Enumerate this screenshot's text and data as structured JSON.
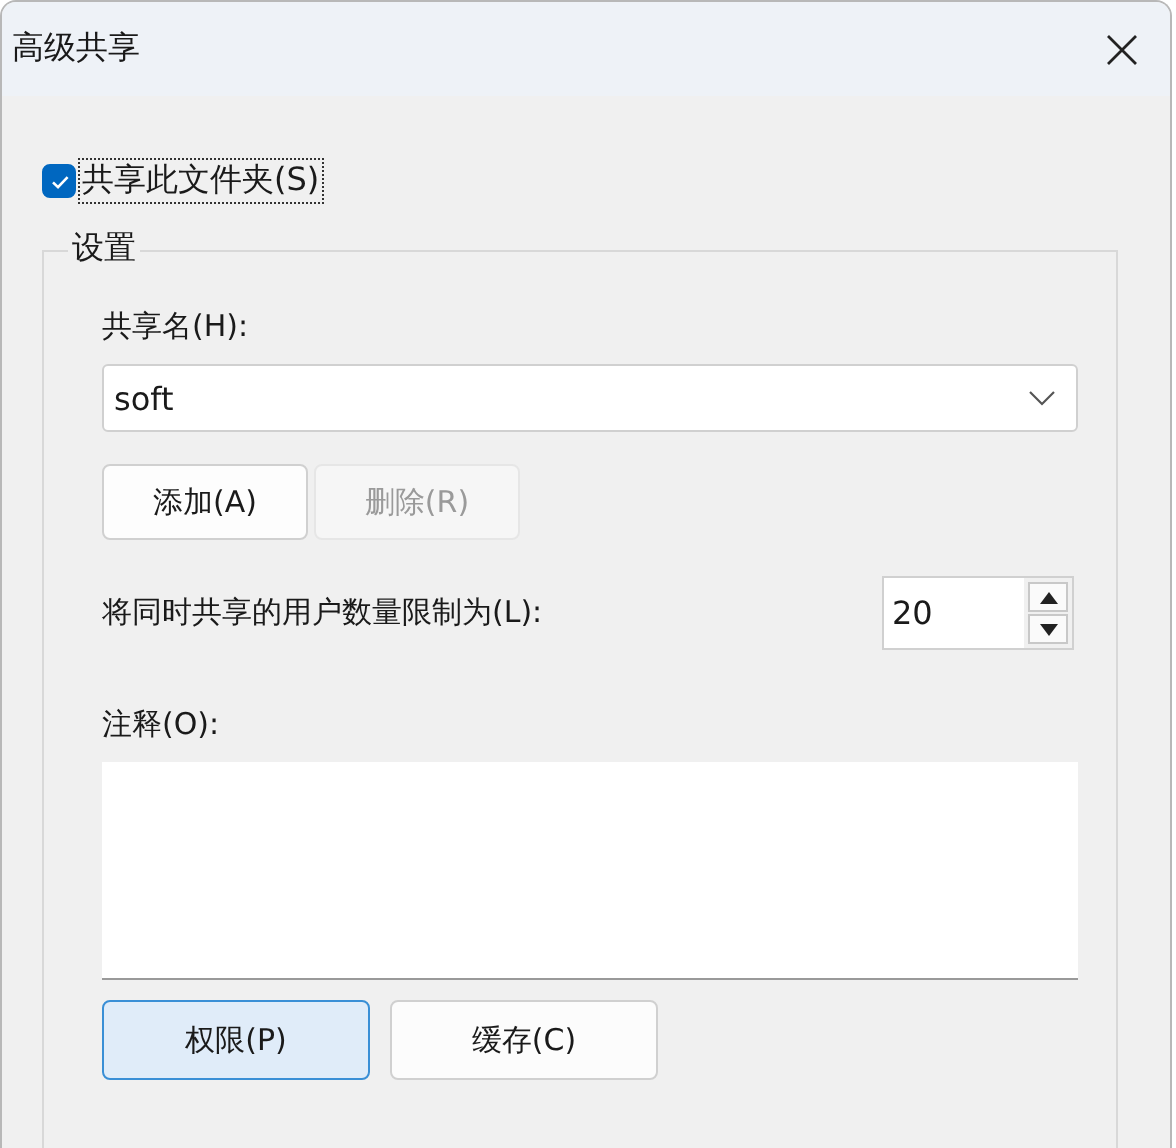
{
  "window": {
    "title": "高级共享"
  },
  "share_checkbox": {
    "label": "共享此文件夹(S)",
    "checked": true
  },
  "settings": {
    "title": "设置",
    "share_name_label": "共享名(H):",
    "share_name": {
      "value": "soft"
    },
    "buttons": [
      {
        "label": "添加(A)",
        "disabled": false
      },
      {
        "label": "删除(R)",
        "disabled": true
      }
    ],
    "limit_label": "将同时共享的用户数量限制为(L):",
    "limit": {
      "value": "20"
    },
    "comment_label": "注释(O):",
    "actions": [
      {
        "label": "权限(P)",
        "focused": true
      },
      {
        "label": "缓存(C)",
        "focused": false
      }
    ]
  }
}
